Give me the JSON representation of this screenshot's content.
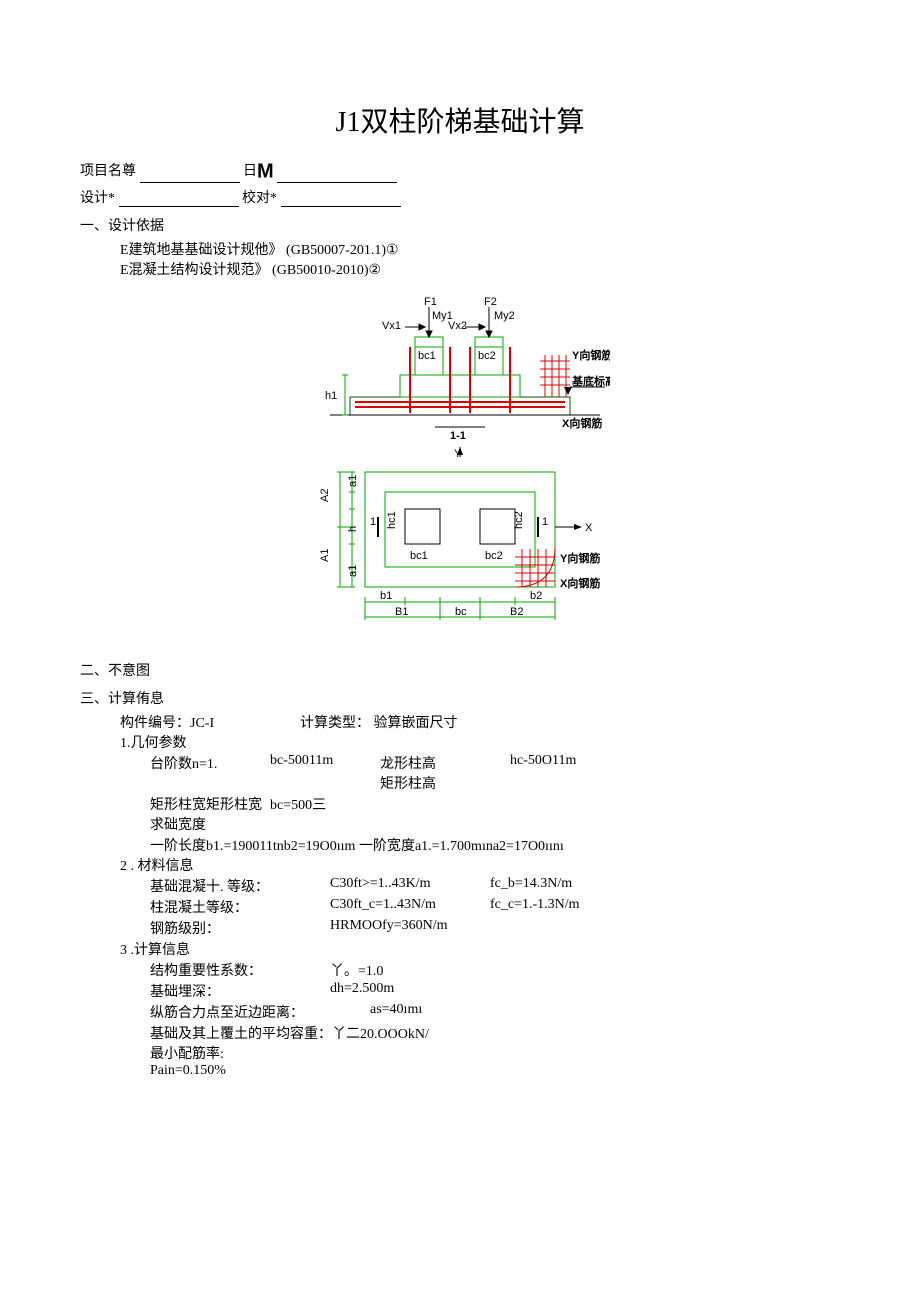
{
  "title": "J1双柱阶梯基础计算",
  "header": {
    "proj_label": "项目名尊",
    "date_glyph": "日",
    "m_glyph": "M",
    "design_label": "设计*",
    "check_label": "校对*"
  },
  "sec1": {
    "title": "一、设计依据",
    "line1": "E建筑地基基础设计规他》  (GB50007-201.1)①",
    "line2": "E混凝土结构设计规范》        (GB50010-2010)②"
  },
  "diagram": {
    "F1": "F1",
    "F2": "F2",
    "Vx1": "Vx1",
    "My1": "My1",
    "Vx2": "Vx2",
    "My2": "My2",
    "bc1": "bc1",
    "bc2": "bc2",
    "h1": "h1",
    "sec11": "1-1",
    "Yrebar": "Y向钢筋",
    "Xrebar": "X向钢筋",
    "baseElev": "基底标高",
    "Y": "Y",
    "X": "X",
    "A2": "A2",
    "A1": "A1",
    "a1": "a1",
    "a1b": "a1",
    "h": "h",
    "hc1": "hc1",
    "hc2": "hc2",
    "b1": "b1",
    "b2": "b2",
    "B1": "B1",
    "bc": "bc",
    "B2": "B2",
    "one_l": "1",
    "one_r": "1"
  },
  "sec2": {
    "title": "二、不意图"
  },
  "sec3": {
    "title": "三、计算侑息",
    "member_label": "构件编号：JC-I",
    "calc_type": "计算类型：  验算嵌面尺寸",
    "s1": {
      "title": "1.几何参数",
      "r1a": "台阶数n=1.",
      "r1b": "bc-50011m",
      "r1c_a": "龙形柱高",
      "r1c_b": "矩形柱高",
      "r1d": "hc-50O11m",
      "r2a": "矩形柱宽矩形柱宽求础宽度",
      "r2b": "bc=500三",
      "r3": "一阶长度b1.=190011tnb2=19O0ıım        一阶宽度a1.=1.700mına2=17O0ıını"
    },
    "s2": {
      "title": "2 . 材料信息",
      "r1a": "基础混凝十. 等级：",
      "r1b": "C30ft>=1..43K/m",
      "r1c": "fc_b=14.3N/m",
      "r2a": "柱混凝土等级：",
      "r2b": "C30ft_c=1..43N/m",
      "r2c": "fc_c=1.-1.3N/m",
      "r3a": "钢筋级别：",
      "r3b": "HRMOOfy=360N/m"
    },
    "s3": {
      "title": "3  .计算信息",
      "r1a": "结构重要性系数：",
      "r1b": "丫。=1.0",
      "r2a": "基础埋深：",
      "r2b": "dh=2.500m",
      "r3a": "纵筋合力点至近边距离：",
      "r3b": "as=40ımı",
      "r4": "基础及其上覆土的平均容重：丫二20.OOOkN/",
      "r5a": "最小配筋率:",
      "r5b": "Pain=0.150%"
    }
  }
}
